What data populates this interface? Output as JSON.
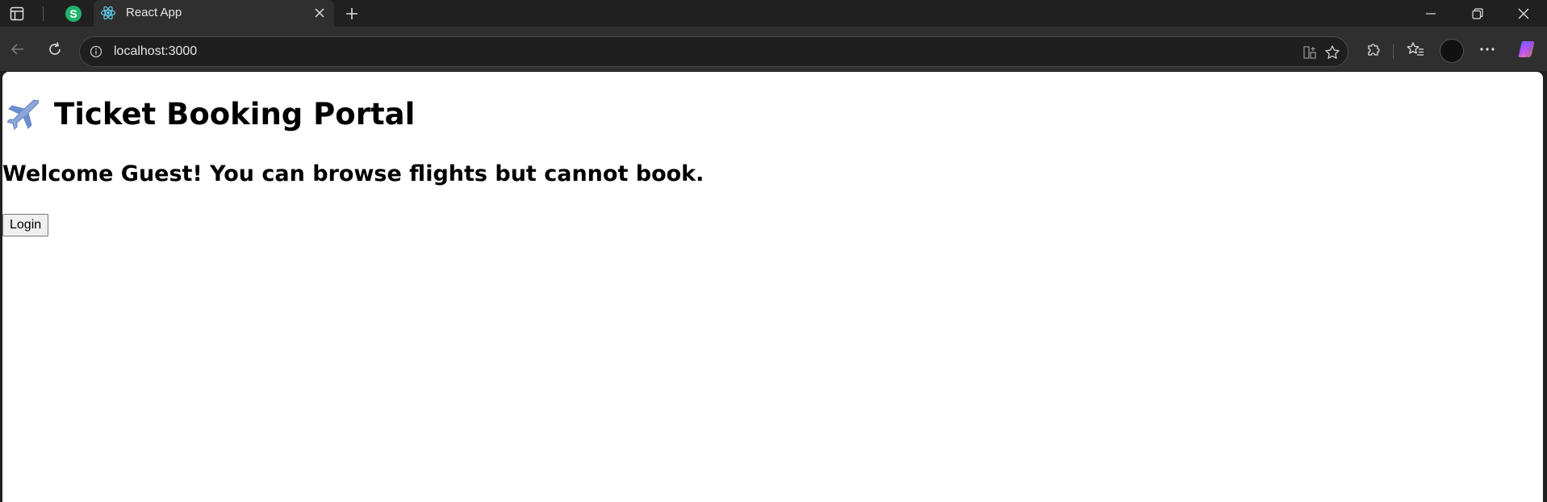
{
  "browser": {
    "tabs": [
      {
        "label": "S",
        "badge_color": "#21b36b"
      },
      {
        "label": "React App",
        "active": true
      }
    ],
    "address": {
      "url": "localhost:3000"
    },
    "icons": {
      "sidebar": "sidebar-icon",
      "new_tab": "plus-icon",
      "back": "back-arrow-icon",
      "reload": "reload-icon",
      "info": "info-icon",
      "split": "split-screen-icon",
      "favorite": "star-icon",
      "extensions": "puzzle-icon",
      "favorites": "favorites-icon",
      "profile": "profile-avatar",
      "menu": "more-icon",
      "copilot": "copilot-icon"
    },
    "window_controls": [
      "minimize",
      "restore",
      "close"
    ]
  },
  "page": {
    "title_icon": "airplane-icon",
    "title": "Ticket Booking Portal",
    "welcome": "Welcome Guest! You can browse flights but cannot book.",
    "login_label": "Login"
  },
  "colors": {
    "chrome_bg": "#202020",
    "toolbar_bg": "#2f2f2f",
    "page_bg": "#ffffff"
  }
}
